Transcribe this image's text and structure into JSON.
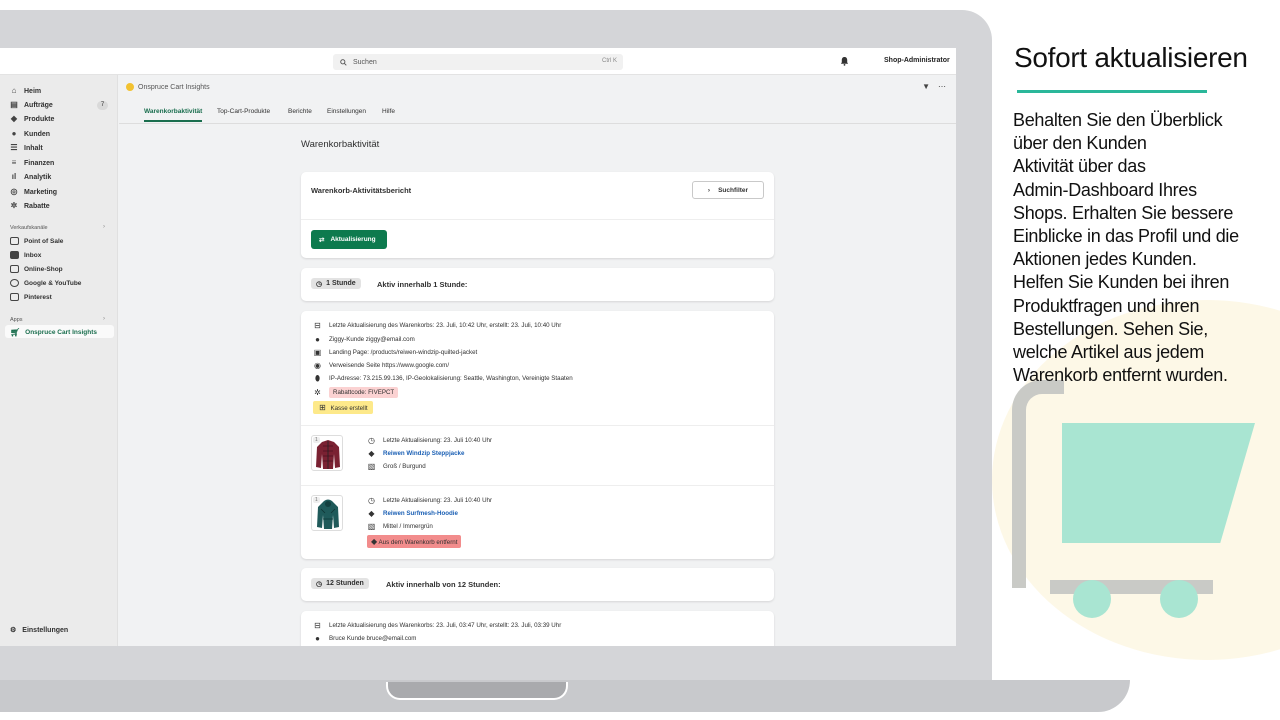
{
  "topbar": {
    "search_placeholder": "Suchen",
    "search_shortcut": "Ctrl K",
    "admin_label": "Shop-Administrator"
  },
  "sidebar": {
    "items": [
      {
        "label": "Heim",
        "icon": "home-icon"
      },
      {
        "label": "Aufträge",
        "icon": "orders-icon",
        "badge": "7"
      },
      {
        "label": "Produkte",
        "icon": "tag-icon"
      },
      {
        "label": "Kunden",
        "icon": "person-icon"
      },
      {
        "label": "Inhalt",
        "icon": "content-icon"
      },
      {
        "label": "Finanzen",
        "icon": "bank-icon"
      },
      {
        "label": "Analytik",
        "icon": "bar-chart-icon"
      },
      {
        "label": "Marketing",
        "icon": "target-icon"
      },
      {
        "label": "Rabatte",
        "icon": "discount-icon"
      }
    ],
    "sales_channels_label": "Verkaufskanäle",
    "sales_channels": [
      {
        "label": "Point of Sale"
      },
      {
        "label": "Inbox"
      },
      {
        "label": "Online-Shop"
      },
      {
        "label": "Google & YouTube"
      },
      {
        "label": "Pinterest"
      }
    ],
    "apps_label": "Apps",
    "apps": [
      {
        "label": "Onspruce Cart Insights"
      }
    ],
    "settings_label": "Einstellungen"
  },
  "app": {
    "title": "Onspruce Cart Insights",
    "tabs": [
      "Warenkorbaktivität",
      "Top-Cart-Produkte",
      "Berichte",
      "Einstellungen",
      "Hilfe"
    ]
  },
  "main": {
    "page_title": "Warenkorbaktivität",
    "report_title": "Warenkorb-Aktivitätsbericht",
    "filter_label": "Suchfilter",
    "refresh_label": "Aktualisierung",
    "group1": {
      "chip": "1 Stunde",
      "label": "Aktiv innerhalb 1 Stunde:"
    },
    "cart1": {
      "last_update": "Letzte Aktualisierung des Warenkorbs: 23. Juli, 10:42 Uhr, erstellt: 23. Juli, 10:40 Uhr",
      "customer": "Ziggy-Kunde ziggy@email.com",
      "landing": "Landing Page: /products/reiwen-windzip-quilted-jacket",
      "referrer": "Verweisende Seite https://www.google.com/",
      "ip": "IP-Adresse: 73.215.99.136, IP-Geolokalisierung: Seattle, Washington, Vereinigte Staaten",
      "discount": "Rabattcode: FIVEPCT",
      "checkout": "Kasse erstellt"
    },
    "product1": {
      "qty": "1",
      "updated": "Letzte Aktualisierung: 23. Juli 10:40 Uhr",
      "name": "Reiwen Windzip Steppjacke",
      "variant": "Groß / Burgund"
    },
    "product2": {
      "qty": "1",
      "updated": "Letzte Aktualisierung: 23. Juli 10:40 Uhr",
      "name": "Reiwen Surfmesh-Hoodie",
      "variant": "Mittel / Immergrün",
      "removed": "Aus dem Warenkorb entfernt"
    },
    "group2": {
      "chip": "12 Stunden",
      "label": "Aktiv innerhalb von 12 Stunden:"
    },
    "cart2": {
      "last_update": "Letzte Aktualisierung des Warenkorbs: 23. Juli, 03:47 Uhr, erstellt: 23. Juli, 03:39 Uhr",
      "customer": "Bruce Kunde bruce@email.com"
    }
  },
  "marketing": {
    "title": "Sofort aktualisieren",
    "lines": [
      "Behalten Sie den Überblick",
      "über den Kunden",
      "Aktivität über das",
      "Admin-Dashboard Ihres",
      "Shops. Erhalten Sie bessere",
      "Einblicke in das Profil und die",
      "Aktionen jedes Kunden.",
      "Helfen Sie Kunden bei ihren",
      "Produktfragen und ihren",
      "Bestellungen. Sehen Sie,",
      "welche Artikel aus jedem",
      "Warenkorb entfernt wurden."
    ]
  },
  "colors": {
    "accent_green": "#0d7a4e",
    "highlight_yellow": "#fde98a",
    "highlight_red": "#f28c8c",
    "teal_rule": "#2ab79a"
  }
}
